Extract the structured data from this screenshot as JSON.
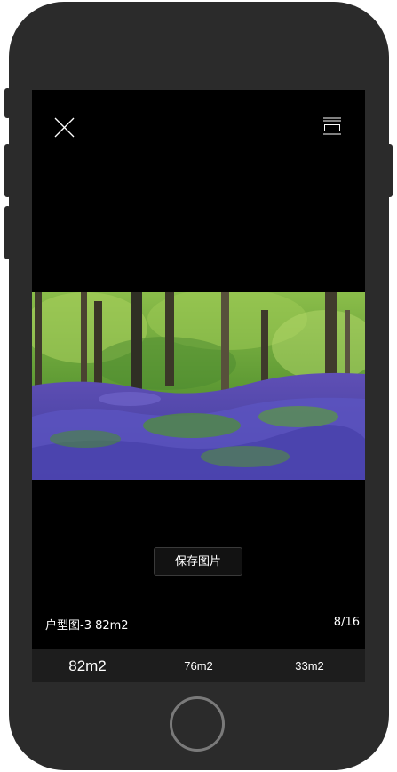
{
  "viewer": {
    "close_icon": "close-icon",
    "menu_icon": "menu-icon",
    "photo_description_icon": "image",
    "save_label": "保存图片",
    "caption": "户型图-3 82m2",
    "counter": "8/16"
  },
  "tabs": [
    {
      "label": "82m2",
      "active": true
    },
    {
      "label": "76m2",
      "active": false
    },
    {
      "label": "33m2",
      "active": false
    }
  ],
  "colors": {
    "phone_body": "#2b2b2b",
    "screen_bg": "#000000",
    "tabbar_bg": "#1d1d1d",
    "text": "#ffffff"
  }
}
